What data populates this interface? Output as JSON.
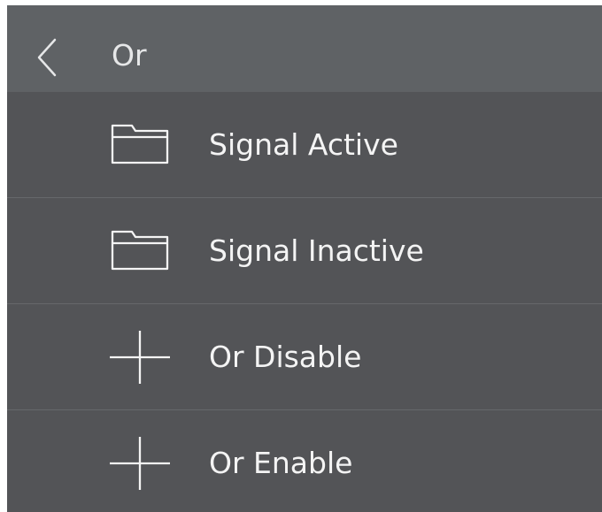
{
  "header": {
    "title": "Or",
    "back_icon": "chevron-left-icon"
  },
  "items": [
    {
      "label": "Signal Active",
      "icon": "folder-icon"
    },
    {
      "label": "Signal Inactive",
      "icon": "folder-icon"
    },
    {
      "label": "Or Disable",
      "icon": "plus-icon"
    },
    {
      "label": "Or Enable",
      "icon": "plus-icon"
    }
  ],
  "colors": {
    "header_background": "#5f6265",
    "list_background": "#535457",
    "text": "#f4f4f4",
    "divider": "#66686b"
  }
}
